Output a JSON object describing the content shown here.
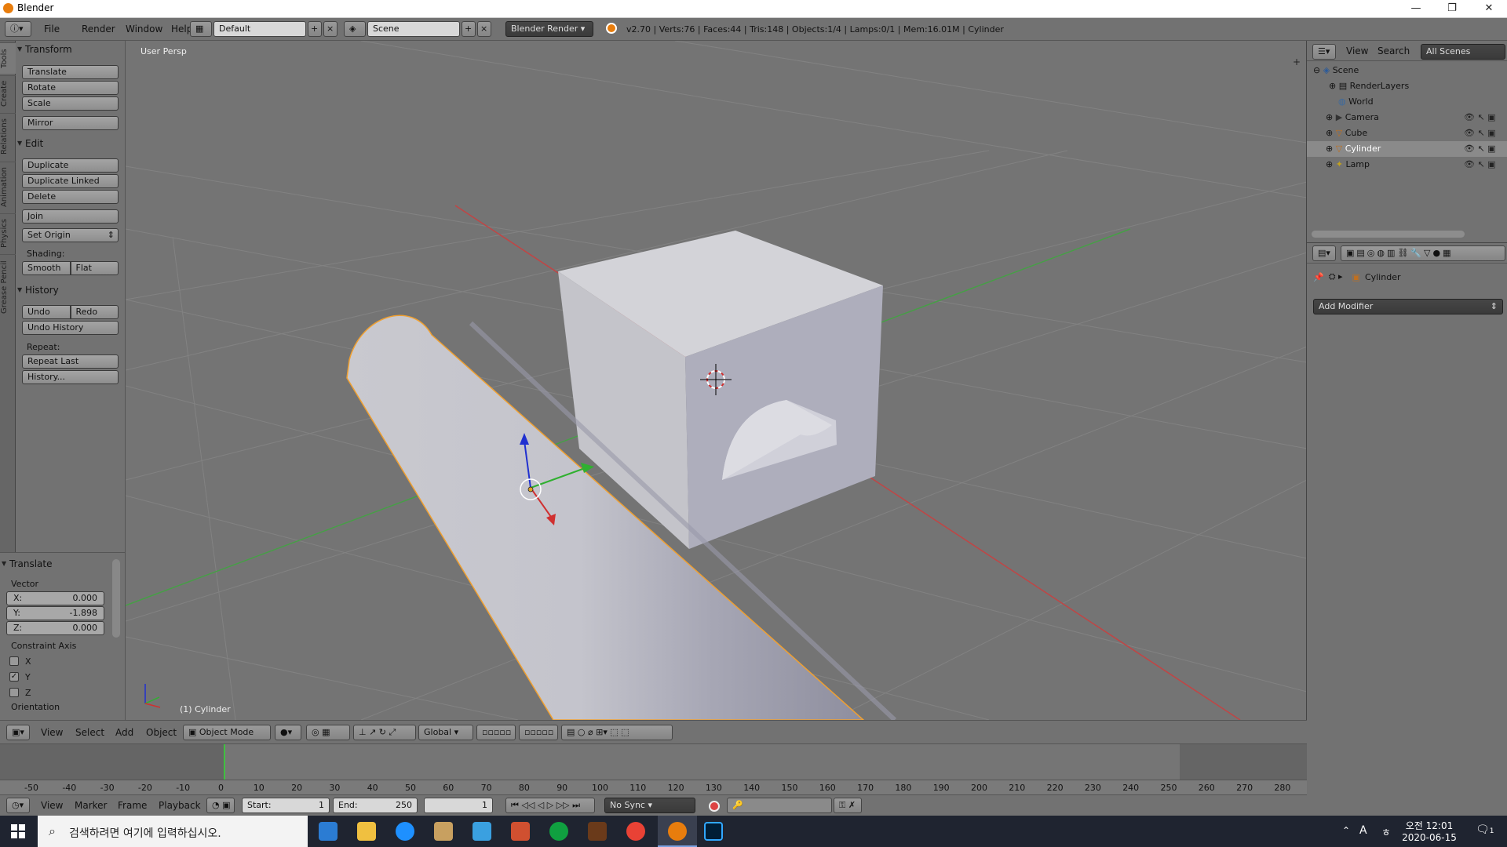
{
  "window": {
    "title": "Blender",
    "controls": [
      "—",
      "❐",
      "✕"
    ]
  },
  "header": {
    "menus": [
      "File",
      "Render",
      "Window",
      "Help"
    ],
    "layout": "Default",
    "scene": "Scene",
    "engine": "Blender Render",
    "stats": "v2.70 | Verts:76 | Faces:44 | Tris:148 | Objects:1/4 | Lamps:0/1 | Mem:16.01M | Cylinder"
  },
  "tool_tabs": [
    "Tools",
    "Create",
    "Relations",
    "Animation",
    "Physics",
    "Grease Pencil"
  ],
  "tool_shelf": {
    "transform": {
      "heading": "Transform",
      "buttons": [
        "Translate",
        "Rotate",
        "Scale",
        "Mirror"
      ]
    },
    "edit": {
      "heading": "Edit",
      "buttons": [
        "Duplicate",
        "Duplicate Linked",
        "Delete",
        "Join",
        "Set Origin"
      ],
      "shading_label": "Shading:",
      "smooth": "Smooth",
      "flat": "Flat"
    },
    "history": {
      "heading": "History",
      "undo": "Undo",
      "redo": "Redo",
      "undo_history": "Undo History",
      "repeat_label": "Repeat:",
      "repeat_last": "Repeat Last",
      "history": "History..."
    }
  },
  "operator": {
    "heading": "Translate",
    "vector_label": "Vector",
    "x_label": "X:",
    "x": "0.000",
    "y_label": "Y:",
    "y": "-1.898",
    "z_label": "Z:",
    "z": "0.000",
    "constraint_label": "Constraint Axis",
    "axes": [
      {
        "label": "X",
        "checked": false
      },
      {
        "label": "Y",
        "checked": true
      },
      {
        "label": "Z",
        "checked": false
      }
    ],
    "orientation_label": "Orientation"
  },
  "viewport": {
    "view_name": "User Persp",
    "object_label": "(1) Cylinder"
  },
  "view3d_header": {
    "menus": [
      "View",
      "Select",
      "Add",
      "Object"
    ],
    "mode": "Object Mode",
    "orientation": "Global"
  },
  "timeline": {
    "ticks": [
      "-50",
      "-40",
      "-30",
      "-20",
      "-10",
      "0",
      "10",
      "20",
      "30",
      "40",
      "50",
      "60",
      "70",
      "80",
      "90",
      "100",
      "110",
      "120",
      "130",
      "140",
      "150",
      "160",
      "170",
      "180",
      "190",
      "200",
      "210",
      "220",
      "230",
      "240",
      "250",
      "260",
      "270",
      "280"
    ],
    "current_frame_value": 0,
    "menus": [
      "View",
      "Marker",
      "Frame",
      "Playback"
    ],
    "start_label": "Start:",
    "start": "1",
    "end_label": "End:",
    "end": "250",
    "current": "1",
    "sync": "No Sync"
  },
  "outliner": {
    "view": "View",
    "search": "Search",
    "filter": "All Scenes",
    "items": [
      {
        "name": "Scene",
        "indent": 0
      },
      {
        "name": "RenderLayers",
        "indent": 1
      },
      {
        "name": "World",
        "indent": 1
      },
      {
        "name": "Camera",
        "indent": 1
      },
      {
        "name": "Cube",
        "indent": 1
      },
      {
        "name": "Cylinder",
        "indent": 1
      },
      {
        "name": "Lamp",
        "indent": 1
      }
    ]
  },
  "properties": {
    "object": "Cylinder",
    "add_modifier": "Add Modifier"
  },
  "taskbar": {
    "search_placeholder": "검색하려면 여기에 입력하십시오.",
    "tray_lang": "A",
    "tray_ime": "ㅎ",
    "time": "오전 12:01",
    "date": "2020-06-15",
    "notifications": "1"
  },
  "colors": {
    "selection_outline": "#f0a030",
    "x_axis": "#d04040",
    "y_axis": "#40b040",
    "z_axis": "#2030d0",
    "frame_cursor": "#40c040"
  }
}
